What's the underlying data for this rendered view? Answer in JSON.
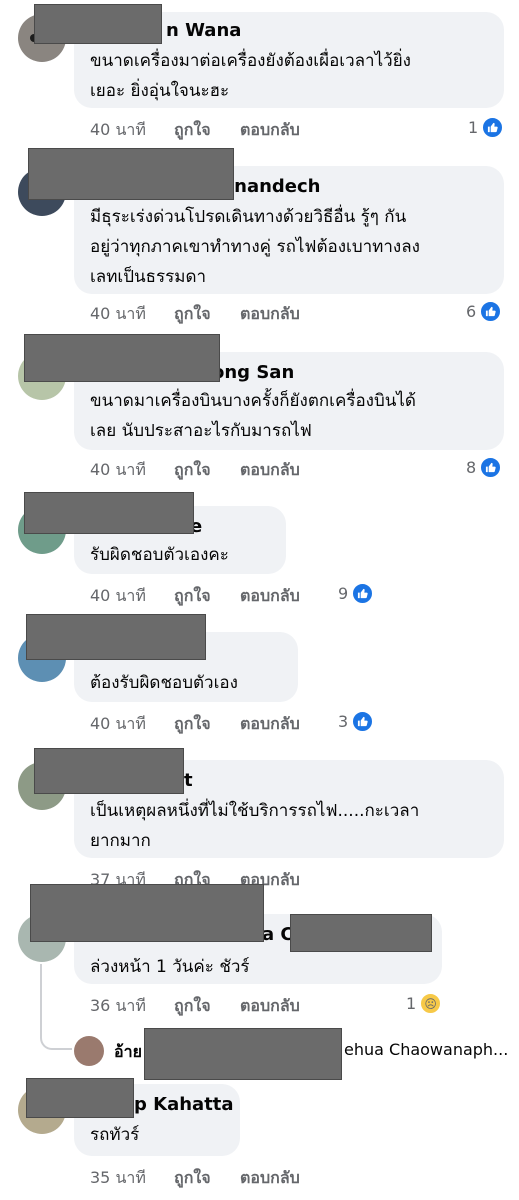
{
  "colors": {
    "bubble": "#f0f2f5",
    "meta": "#65676b",
    "like": "#1b74e4",
    "redact": "#6b6b6b"
  },
  "actions": {
    "like": "ถูกใจ",
    "reply": "ตอบกลับ"
  },
  "comments": [
    {
      "name": "n Wana",
      "lines": [
        "ขนาดเครื่องมาต่อเครื่องยังต้องเผื่อเวลาไว้ยิ่ง",
        "เยอะ ยิ่งอุ่นใจนะฮะ"
      ],
      "time": "40 นาที",
      "reactions": "1"
    },
    {
      "name": "anandech",
      "lines": [
        "มีธุระเร่งด่วนโปรดเดินทางด้วยวิธีอื่น รู้ๆ กัน",
        "อยู่ว่าทุกภาคเขาทำทางคู่ รถไฟต้องเบาทางลง",
        "เลทเป็นธรรมดา"
      ],
      "time": "40 นาที",
      "reactions": "6"
    },
    {
      "name": "ong San",
      "lines": [
        "ขนาดมาเครื่องบินบางครั้งก็ยังตกเครื่องบินได้",
        "เลย นับประสาอะไรกับมารถไฟ"
      ],
      "time": "40 นาที",
      "reactions": "8"
    },
    {
      "name": "e",
      "lines": [
        "รับผิดชอบตัวเองคะ"
      ],
      "time": "40 นาที",
      "reactions": "9"
    },
    {
      "name": "",
      "lines": [
        "ต้องรับผิดชอบตัวเอง"
      ],
      "time": "40 นาที",
      "reactions": "3"
    },
    {
      "name": "t",
      "lines": [
        "เป็นเหตุผลหนึ่งที่ไม่ใช้บริการรถไฟ.....กะเวลา",
        "ยากมาก"
      ],
      "time": "37 นาที",
      "reactions": ""
    },
    {
      "name": "a C",
      "lines": [
        "ล่วงหน้า 1 วันค่ะ ชัวร์"
      ],
      "time": "36 นาที",
      "reactions": "1"
    },
    {
      "name": "p Kahatta",
      "lines": [
        "รถทัวร์"
      ],
      "time": "35 นาที",
      "reactions": ""
    }
  ],
  "reply": {
    "prefix": "อ้าย",
    "suffix": "ehua Chaowanaph..."
  }
}
